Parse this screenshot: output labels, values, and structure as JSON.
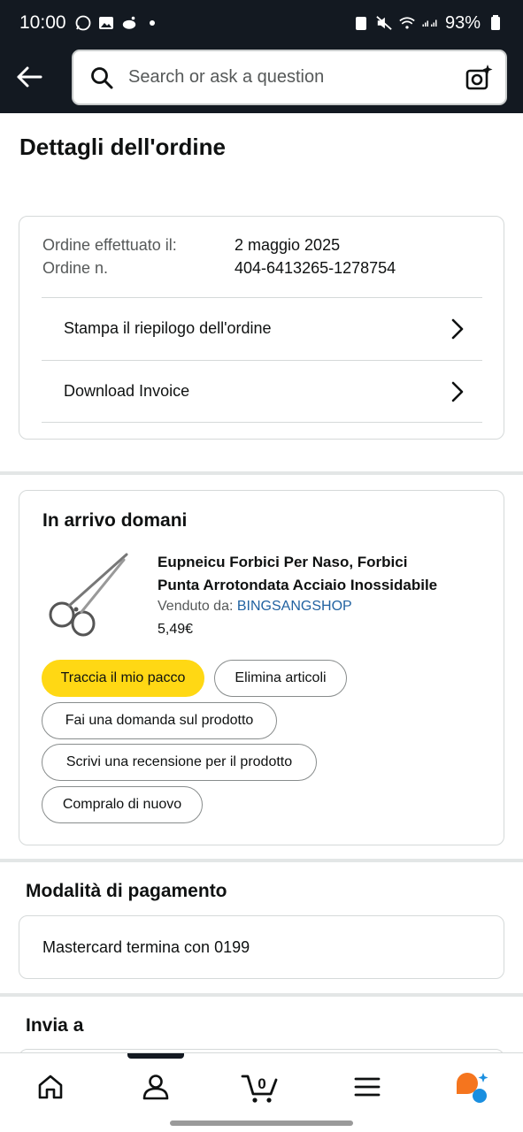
{
  "status_bar": {
    "time": "10:00",
    "battery": "93%"
  },
  "header": {
    "search_placeholder": "Search or ask a question"
  },
  "page_title": "Dettagli dell'ordine",
  "order_info": {
    "placed_label": "Ordine effettuato il:",
    "placed_value": "2 maggio 2025",
    "number_label": "Ordine n.",
    "number_value": "404-6413265-1278754",
    "links": [
      {
        "label": "Stampa il riepilogo dell'ordine"
      },
      {
        "label": "Download Invoice"
      }
    ]
  },
  "shipment": {
    "heading": "In arrivo domani",
    "product_line1": "Eupneicu Forbici Per Naso, Forbici",
    "product_line2": "Punta Arrotondata Acciaio Inossidabile",
    "sold_by_label": "Venduto da:",
    "seller": "BINGSANGSHOP",
    "price": "5,49€",
    "actions": [
      {
        "label": "Traccia il mio pacco"
      },
      {
        "label": "Elimina articoli"
      },
      {
        "label": "Fai una domanda sul prodotto"
      },
      {
        "label": "Scrivi una recensione per il prodotto"
      },
      {
        "label": "Compralo di nuovo"
      }
    ]
  },
  "payment": {
    "heading": "Modalità di pagamento",
    "method": "Mastercard  termina con 0199"
  },
  "ship_to": {
    "heading": "Invia a"
  },
  "bottom_nav": {
    "cart_count": "0",
    "items": [
      "home-icon",
      "account-icon",
      "cart-icon",
      "menu-icon",
      "rufus-icon"
    ]
  },
  "colors": {
    "header_bg": "#131921",
    "primary_button": "#ffd814",
    "link": "#2162a1"
  }
}
